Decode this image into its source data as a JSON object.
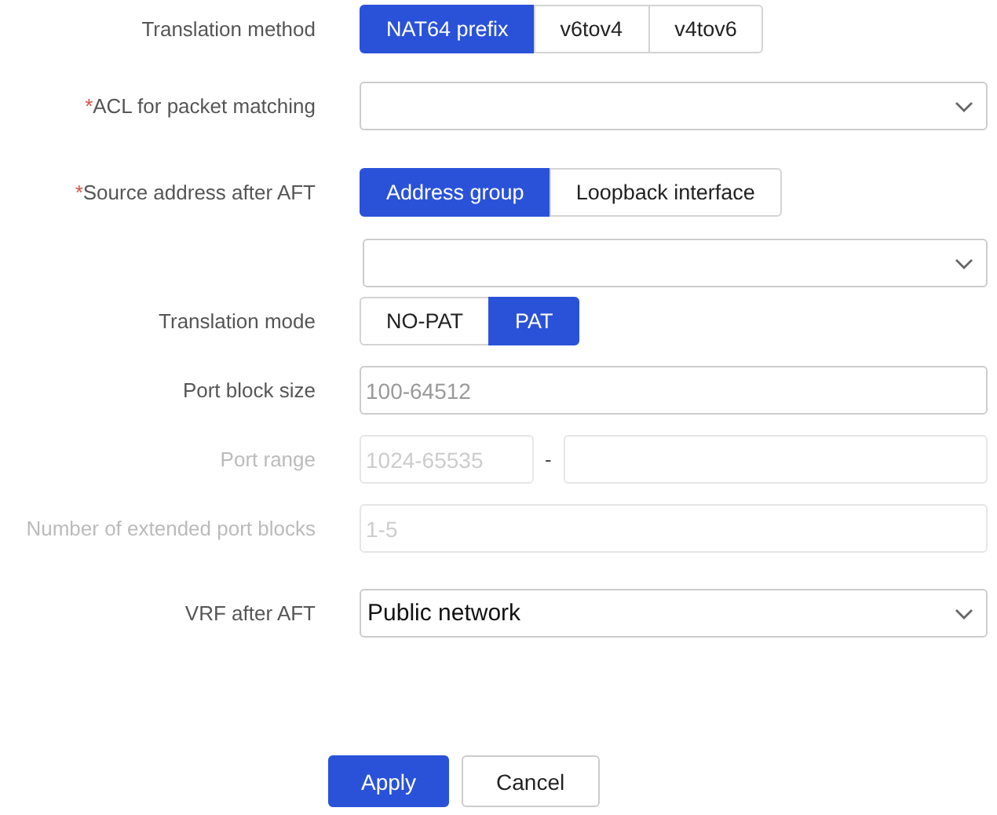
{
  "fields": [
    {
      "kind": "segmented",
      "label": "Translation method",
      "disabled": false,
      "options": [
        {
          "label": "NAT64 prefix",
          "selected": true
        },
        {
          "label": "v6tov4",
          "selected": false
        },
        {
          "label": "v4tov6",
          "selected": false
        }
      ]
    },
    {
      "kind": "select",
      "label": "ACL for packet matching",
      "required_mark": "*",
      "disabled": false
    },
    {
      "kind": "segmented",
      "label": "Source address after AFT",
      "required_mark": "*",
      "disabled": false,
      "options": [
        {
          "label": "Address group",
          "selected": true
        },
        {
          "label": "Loopback interface",
          "selected": false
        }
      ]
    },
    {
      "kind": "select",
      "disabled": false
    },
    {
      "kind": "segmented",
      "label": "Translation mode",
      "disabled": false,
      "options": [
        {
          "label": "NO-PAT",
          "selected": false
        },
        {
          "label": "PAT",
          "selected": true
        }
      ]
    },
    {
      "kind": "text",
      "label": "Port block size",
      "disabled": false,
      "placeholder": "100-64512"
    },
    {
      "kind": "range",
      "label": "Port range",
      "disabled": true,
      "placeholder": "1024-65535",
      "separator": "-"
    },
    {
      "kind": "text",
      "label": "Number of extended port blocks",
      "disabled": true,
      "placeholder": "1-5"
    },
    {
      "kind": "select",
      "label": "VRF after AFT",
      "disabled": false,
      "value": "Public network"
    }
  ],
  "buttons": [
    {
      "label": "Apply",
      "primary": true
    },
    {
      "label": "Cancel",
      "primary": false
    }
  ]
}
